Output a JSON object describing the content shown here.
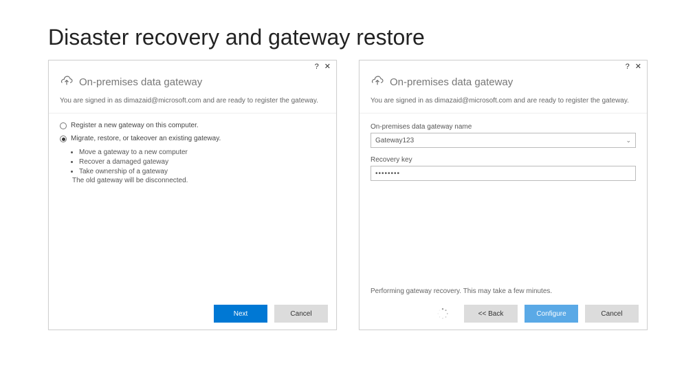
{
  "slide": {
    "title": "Disaster recovery and gateway restore"
  },
  "dialog1": {
    "title": "On-premises data gateway",
    "signed_in": "You are signed in as dimazaid@microsoft.com and are ready to register the gateway.",
    "radio1_label": "Register a new gateway on this computer.",
    "radio2_label": "Migrate, restore, or takeover an existing gateway.",
    "bullet1": "Move a gateway to a new computer",
    "bullet2": "Recover a damaged gateway",
    "bullet3": "Take ownership of a gateway",
    "disconnect_note": "The old gateway will be disconnected.",
    "next_label": "Next",
    "cancel_label": "Cancel"
  },
  "dialog2": {
    "title": "On-premises data gateway",
    "signed_in": "You are signed in as dimazaid@microsoft.com and are ready to register the gateway.",
    "gateway_name_label": "On-premises data gateway name",
    "gateway_name_value": "Gateway123",
    "recovery_key_label": "Recovery key",
    "recovery_key_value": "••••••••",
    "status_text": "Performing gateway recovery. This may take a few minutes.",
    "back_label": "<< Back",
    "configure_label": "Configure",
    "cancel_label": "Cancel"
  }
}
